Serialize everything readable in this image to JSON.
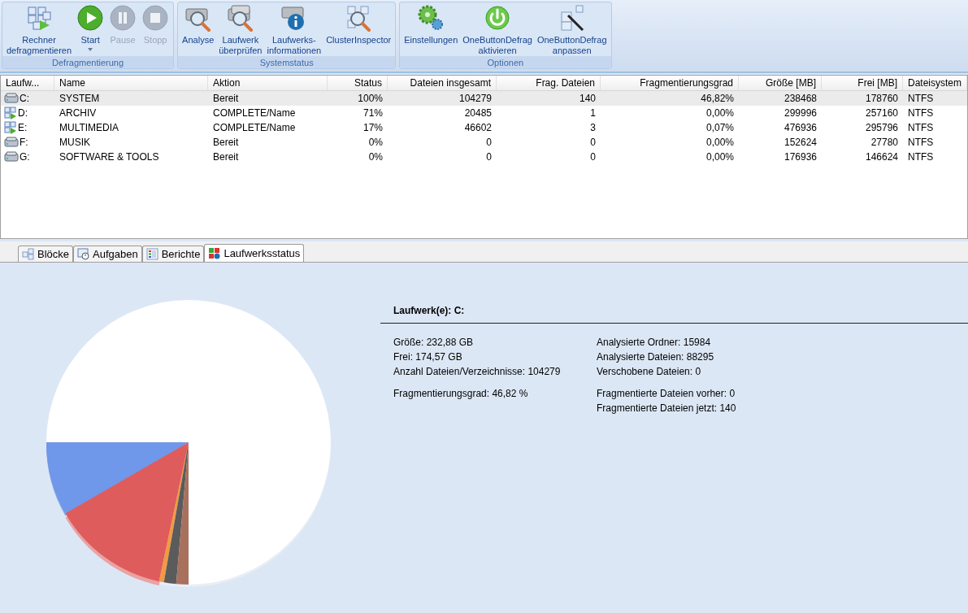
{
  "ribbon": {
    "groups": [
      {
        "label": "Defragmentierung",
        "buttons": [
          {
            "kind": "defrag",
            "label": "Rechner\ndefragmentieren",
            "disabled": false,
            "dropdown": false
          },
          {
            "kind": "play",
            "label": "Start",
            "disabled": false,
            "dropdown": true
          },
          {
            "kind": "pause",
            "label": "Pause",
            "disabled": true,
            "dropdown": false
          },
          {
            "kind": "stop",
            "label": "Stopp",
            "disabled": true,
            "dropdown": false
          }
        ]
      },
      {
        "label": "Systemstatus",
        "buttons": [
          {
            "kind": "analyze",
            "label": "Analyse",
            "disabled": false,
            "dropdown": false
          },
          {
            "kind": "check",
            "label": "Laufwerk\nüberprüfen",
            "disabled": false,
            "dropdown": false
          },
          {
            "kind": "info",
            "label": "Laufwerks-\ninformationen",
            "disabled": false,
            "dropdown": false
          },
          {
            "kind": "cluster",
            "label": "ClusterInspector",
            "disabled": false,
            "dropdown": false
          }
        ]
      },
      {
        "label": "Optionen",
        "buttons": [
          {
            "kind": "gears",
            "label": "Einstellungen",
            "disabled": false,
            "dropdown": false
          },
          {
            "kind": "power",
            "label": "OneButtonDefrag\naktivieren",
            "disabled": false,
            "dropdown": false
          },
          {
            "kind": "wand",
            "label": "OneButtonDefrag\nanpassen",
            "disabled": false,
            "dropdown": false
          }
        ]
      }
    ]
  },
  "table": {
    "columns": [
      "Laufw...",
      "Name",
      "Aktion",
      "Status",
      "Dateien insgesamt",
      "Frag. Dateien",
      "Fragmentierungsgrad",
      "Größe [MB]",
      "Frei [MB]",
      "Dateisystem"
    ],
    "rows": [
      {
        "kind": "disk",
        "selected": true,
        "cells": [
          "C:",
          "SYSTEM",
          "Bereit",
          "100%",
          "104279",
          "140",
          "46,82%",
          "238468",
          "178760",
          "NTFS"
        ]
      },
      {
        "kind": "defrag",
        "selected": false,
        "cells": [
          "D:",
          "ARCHIV",
          "COMPLETE/Name",
          "71%",
          "20485",
          "1",
          "0,00%",
          "299996",
          "257160",
          "NTFS"
        ]
      },
      {
        "kind": "defrag",
        "selected": false,
        "cells": [
          "E:",
          "MULTIMEDIA",
          "COMPLETE/Name",
          "17%",
          "46602",
          "3",
          "0,07%",
          "476936",
          "295796",
          "NTFS"
        ]
      },
      {
        "kind": "disk",
        "selected": false,
        "cells": [
          "F:",
          "MUSIK",
          "Bereit",
          "0%",
          "0",
          "0",
          "0,00%",
          "152624",
          "27780",
          "NTFS"
        ]
      },
      {
        "kind": "disk",
        "selected": false,
        "cells": [
          "G:",
          "SOFTWARE & TOOLS",
          "Bereit",
          "0%",
          "0",
          "0",
          "0,00%",
          "176936",
          "146624",
          "NTFS"
        ]
      }
    ]
  },
  "tabs": [
    {
      "kind": "blocks",
      "label": "Blöcke",
      "selected": false
    },
    {
      "kind": "clock",
      "label": "Aufgaben",
      "selected": false
    },
    {
      "kind": "report",
      "label": "Berichte",
      "selected": false
    },
    {
      "kind": "status",
      "label": "Laufwerksstatus",
      "selected": true
    }
  ],
  "status": {
    "title": "Laufwerk(e): C:",
    "left": [
      [
        "Größe: 232,88 GB",
        "Frei: 174,57 GB",
        "Anzahl Dateien/Verzeichnisse: 104279"
      ],
      [
        "Fragmentierungsgrad: 46,82 %"
      ]
    ],
    "right": [
      [
        "Analysierte Ordner: 15984",
        "Analysierte Dateien: 88295",
        "Verschobene Dateien: 0"
      ],
      [
        "Fragmentierte Dateien vorher: 0",
        "Fragmentierte Dateien jetzt: 140"
      ]
    ]
  }
}
